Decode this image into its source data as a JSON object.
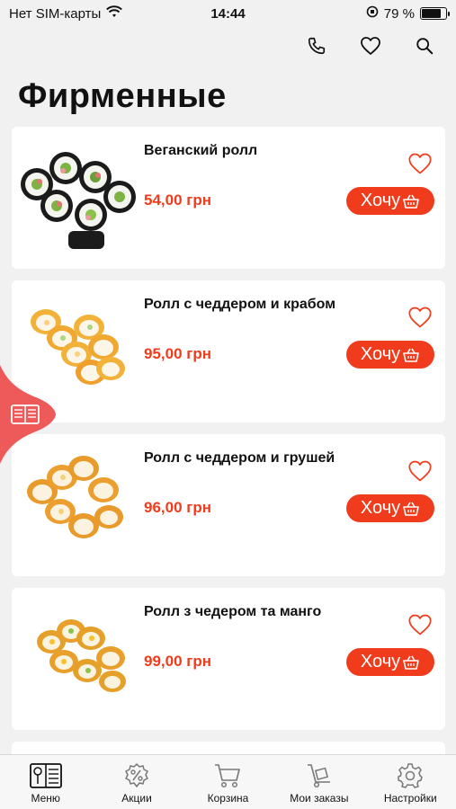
{
  "status_bar": {
    "carrier": "Нет SIM-карты",
    "time": "14:44",
    "battery": "79 %",
    "battery_level": 0.79
  },
  "header": {
    "title": "Фирменные",
    "icons": [
      "phone-icon",
      "heart-icon",
      "search-icon"
    ]
  },
  "products": [
    {
      "name": "Веганский ролл",
      "price": "54,00 грн",
      "button": "Хочу"
    },
    {
      "name": "Ролл с чеддером и крабом",
      "price": "95,00 грн",
      "button": "Хочу"
    },
    {
      "name": "Ролл с чеддером и грушей",
      "price": "96,00 грн",
      "button": "Хочу"
    },
    {
      "name": "Ролл з чедером та манго",
      "price": "99,00 грн",
      "button": "Хочу"
    }
  ],
  "bottom_nav": [
    {
      "label": "Меню",
      "icon": "menu-book-icon"
    },
    {
      "label": "Акции",
      "icon": "percent-badge-icon"
    },
    {
      "label": "Корзина",
      "icon": "cart-icon"
    },
    {
      "label": "Мои заказы",
      "icon": "dolly-icon"
    },
    {
      "label": "Настройки",
      "icon": "gear-icon"
    }
  ],
  "colors": {
    "accent": "#f03c1c",
    "side_tab": "#ee5a5a",
    "background": "#f1f1f1"
  }
}
